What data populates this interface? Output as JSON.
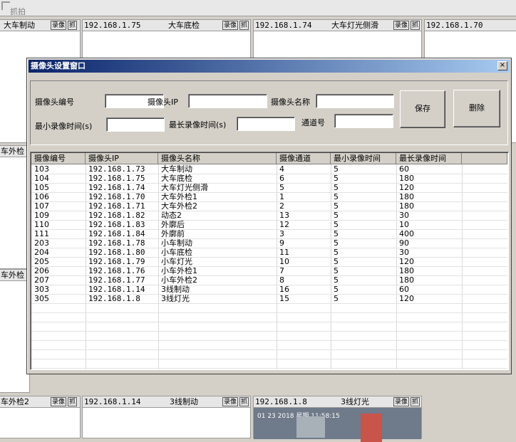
{
  "toolbar": {
    "grab_label": "抓拍"
  },
  "cells": {
    "btn_video": "录像",
    "btn_grab": "抓",
    "top": [
      {
        "ip": "",
        "name": "大车制动"
      },
      {
        "ip": "192.168.1.75",
        "name": "大车底检"
      },
      {
        "ip": "192.168.1.74",
        "name": "大车灯光侧滑"
      },
      {
        "ip": "192.168.1.70",
        "name": ""
      }
    ],
    "mid_left": [
      "车外检",
      "车外检"
    ],
    "bottom": [
      {
        "ip": "",
        "name": "车外检2"
      },
      {
        "ip": "192.168.1.14",
        "name": "3线制动"
      },
      {
        "ip": "192.168.1.8",
        "name": "3线灯光"
      }
    ],
    "video_timestamp": "01 23 2018 星期    11:58:15"
  },
  "dialog": {
    "title": "摄像头设置窗口",
    "close_glyph": "×",
    "form": {
      "camera_id_label": "摄像头编号",
      "camera_ip_label": "摄像头IP",
      "camera_name_label": "摄像头名称",
      "min_rec_label": "最小录像时间(s)",
      "max_rec_label": "最长录像时间(s)",
      "channel_label": "通道号",
      "camera_id_value": "",
      "camera_ip_value": "",
      "camera_name_value": "",
      "min_rec_value": "",
      "max_rec_value": "",
      "channel_value": ""
    },
    "save_label": "保存",
    "delete_label": "删除",
    "table": {
      "columns": [
        "摄像编号",
        "摄像头IP",
        "摄像头名称",
        "摄像通道",
        "最小录像时间",
        "最长录像时间"
      ],
      "rows": [
        [
          "103",
          "192.168.1.73",
          "大车制动",
          "4",
          "5",
          "60"
        ],
        [
          "104",
          "192.168.1.75",
          "大车底检",
          "6",
          "5",
          "180"
        ],
        [
          "105",
          "192.168.1.74",
          "大车灯光侧滑",
          "5",
          "5",
          "120"
        ],
        [
          "106",
          "192.168.1.70",
          "大车外检1",
          "1",
          "5",
          "180"
        ],
        [
          "107",
          "192.168.1.71",
          "大车外检2",
          "2",
          "5",
          "180"
        ],
        [
          "109",
          "192.168.1.82",
          "动态2",
          "13",
          "5",
          "30"
        ],
        [
          "110",
          "192.168.1.83",
          "外廓后",
          "12",
          "5",
          "10"
        ],
        [
          "111",
          "192.168.1.84",
          "外廓前",
          "3",
          "5",
          "400"
        ],
        [
          "203",
          "192.168.1.78",
          "小车制动",
          "9",
          "5",
          "90"
        ],
        [
          "204",
          "192.168.1.80",
          "小车底检",
          "11",
          "5",
          "30"
        ],
        [
          "205",
          "192.168.1.79",
          "小车灯光",
          "10",
          "5",
          "120"
        ],
        [
          "206",
          "192.168.1.76",
          "小车外检1",
          "7",
          "5",
          "180"
        ],
        [
          "207",
          "192.168.1.77",
          "小车外检2",
          "8",
          "5",
          "180"
        ],
        [
          "303",
          "192.168.1.14",
          "3线制动",
          "16",
          "5",
          "60"
        ],
        [
          "305",
          "192.168.1.8",
          "3线灯光",
          "15",
          "5",
          "120"
        ]
      ]
    }
  }
}
